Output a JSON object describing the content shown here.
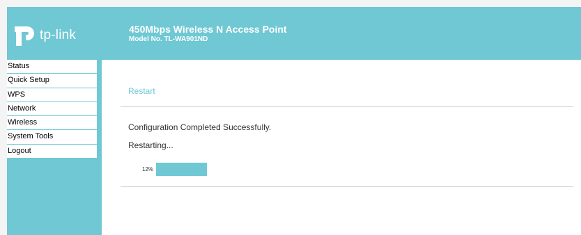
{
  "header": {
    "brand": "tp-link",
    "title": "450Mbps Wireless N Access Point",
    "model": "Model No. TL-WA901ND",
    "accent_color": "#6fc8d4",
    "logo_icon": "tp-link-logo-icon"
  },
  "sidebar": {
    "items": [
      {
        "label": "Status"
      },
      {
        "label": "Quick Setup"
      },
      {
        "label": "WPS"
      },
      {
        "label": "Network"
      },
      {
        "label": "Wireless"
      },
      {
        "label": "System Tools"
      },
      {
        "label": "Logout"
      }
    ]
  },
  "main": {
    "section_title": "Restart",
    "message": "Configuration Completed Successfully.",
    "restarting": "Restarting...",
    "progress": {
      "label": "12%",
      "percent": 12
    }
  }
}
